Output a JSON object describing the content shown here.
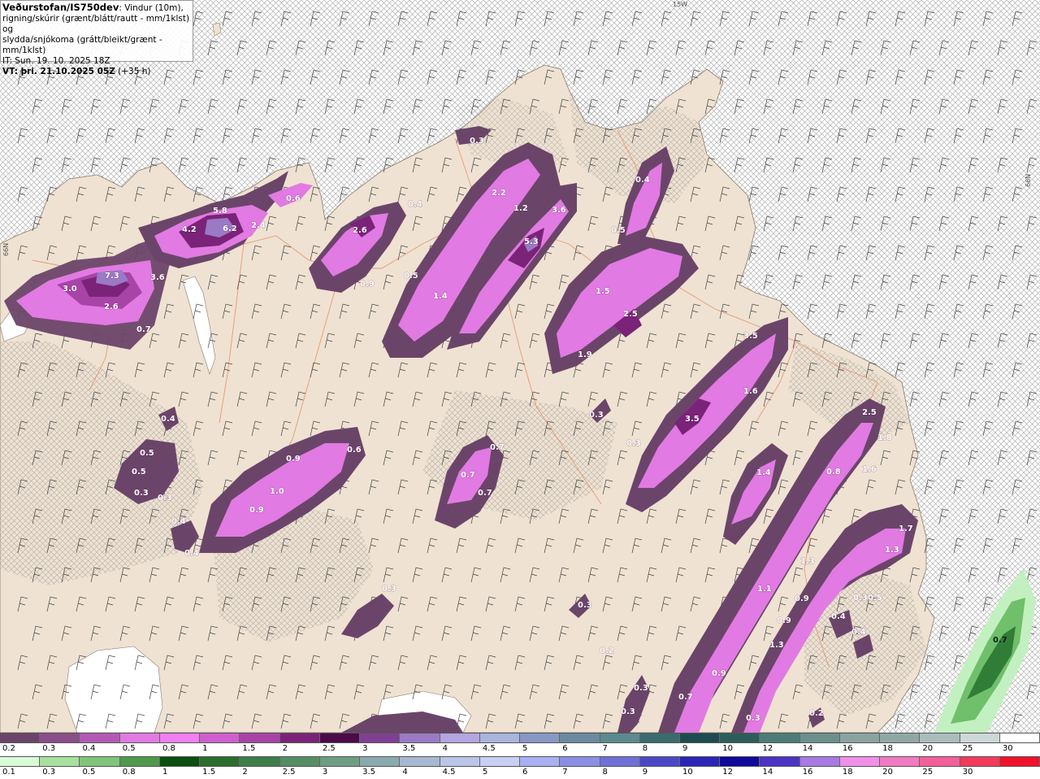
{
  "header": {
    "source": "Veðurstofan/IS750dev",
    "desc_1": ": Vindur (10m),",
    "desc_2": "rigning/skúrir (grænt/blátt/rautt - mm/1klst) og",
    "desc_3": "slydda/snjókoma (grátt/bleikt/grænt - mm/1klst)",
    "init_time": "IT: Sun. 19. 10. 2025 18Z",
    "valid_time": "VT: þri. 21.10.2025 05Z",
    "lead_time": "(+35 h)"
  },
  "edge_labels": {
    "top": "15W",
    "right": "66N",
    "left": "66N"
  },
  "colors": {
    "sea": "#ffffff",
    "land": "#efe2d2",
    "roads": "#e8906b",
    "rain_light": "#c3f0c0",
    "rain_mid": "#6fbf6b",
    "rain_dark": "#2f7d36"
  },
  "legend_snow": {
    "labels": [
      "0.2",
      "0.3",
      "0.4",
      "0.5",
      "0.8",
      "1",
      "1.5",
      "2",
      "2.5",
      "3",
      "3.5",
      "4",
      "4.5",
      "5",
      "6",
      "7",
      "8",
      "9",
      "10",
      "12",
      "14",
      "16",
      "18",
      "20",
      "25",
      "30"
    ],
    "colors": [
      "#6b4569",
      "#8a4e8a",
      "#b25ab3",
      "#e17ae2",
      "#f07ff0",
      "#cf5fcf",
      "#a844a8",
      "#7a2378",
      "#4b0a49",
      "#7f3f93",
      "#9a7ac4",
      "#b3a6e0",
      "#a8b5dc",
      "#8798c4",
      "#6b8aa0",
      "#5b8a8f",
      "#3a6b6e",
      "#1c4c50",
      "#2d5d5a",
      "#4d7d78",
      "#6b8f8c",
      "#8aa3a1",
      "#8fa8a6",
      "#aabcbc",
      "#cdd8d8",
      "#ffffff"
    ]
  },
  "legend_rain": {
    "labels": [
      "0.1",
      "0.3",
      "0.5",
      "0.8",
      "1",
      "1.5",
      "2",
      "2.5",
      "3",
      "3.5",
      "4",
      "4.5",
      "5",
      "6",
      "7",
      "8",
      "9",
      "10",
      "12",
      "14",
      "16",
      "18",
      "20",
      "25",
      "30",
      ""
    ],
    "colors": [
      "#d9fbd5",
      "#a8e0a0",
      "#7ec57a",
      "#4e9a4c",
      "#0b4f12",
      "#2a6e2e",
      "#3c7f4a",
      "#548d64",
      "#6e9e82",
      "#8aaab0",
      "#a7b8d2",
      "#bac5e8",
      "#c7cff4",
      "#a8b0f0",
      "#8a8fe5",
      "#6f6fd8",
      "#4b48c7",
      "#2a25b4",
      "#0f0a99",
      "#4b33c4",
      "#a879e2",
      "#f08fe8",
      "#f27ac2",
      "#f25f99",
      "#f23a5a",
      "#f0122a"
    ]
  },
  "value_labels": [
    {
      "t": "0.3"
    },
    {
      "t": "0.4"
    },
    {
      "t": "2.2"
    },
    {
      "t": "1.2"
    },
    {
      "t": "3.6"
    },
    {
      "t": "5.3"
    },
    {
      "t": "0.4"
    },
    {
      "t": "0.5"
    },
    {
      "t": "5.8"
    },
    {
      "t": "4.2"
    },
    {
      "t": "6.2"
    },
    {
      "t": "2.4"
    },
    {
      "t": "0.6"
    },
    {
      "t": "7.3"
    },
    {
      "t": "3.0"
    },
    {
      "t": "3.6"
    },
    {
      "t": "2.6"
    },
    {
      "t": "0.7"
    },
    {
      "t": "2.6"
    },
    {
      "t": "0.9"
    },
    {
      "t": "0.5"
    },
    {
      "t": "1.4"
    },
    {
      "t": "1.5"
    },
    {
      "t": "2.5"
    },
    {
      "t": "1.9"
    },
    {
      "t": "3.5"
    },
    {
      "t": "1.6"
    },
    {
      "t": "3.5"
    },
    {
      "t": "0.3"
    },
    {
      "t": "0.3"
    },
    {
      "t": "0.4"
    },
    {
      "t": "0.5"
    },
    {
      "t": "0.5"
    },
    {
      "t": "0.3"
    },
    {
      "t": "0.3"
    },
    {
      "t": "0.4"
    },
    {
      "t": "0.4"
    },
    {
      "t": "0.6"
    },
    {
      "t": "0.9"
    },
    {
      "t": "1.0"
    },
    {
      "t": "0.9"
    },
    {
      "t": "0.7"
    },
    {
      "t": "0.7"
    },
    {
      "t": "0.7"
    },
    {
      "t": "1.4"
    },
    {
      "t": "2.5"
    },
    {
      "t": "1.8"
    },
    {
      "t": "0.8"
    },
    {
      "t": "1.6"
    },
    {
      "t": "1.7"
    },
    {
      "t": "1.3"
    },
    {
      "t": "1.3"
    },
    {
      "t": "1.1"
    },
    {
      "t": "0.9"
    },
    {
      "t": "0.9"
    },
    {
      "t": "1.3"
    },
    {
      "t": "0.9"
    },
    {
      "t": "0.7"
    },
    {
      "t": "0.3"
    },
    {
      "t": "0.3"
    },
    {
      "t": "0.3"
    },
    {
      "t": "0.3"
    },
    {
      "t": "0.4"
    },
    {
      "t": "0.4"
    },
    {
      "t": "0.3"
    },
    {
      "t": "0.7"
    },
    {
      "t": "0.5"
    },
    {
      "t": "0.2"
    },
    {
      "t": "0.2"
    },
    {
      "t": "0.3"
    }
  ]
}
